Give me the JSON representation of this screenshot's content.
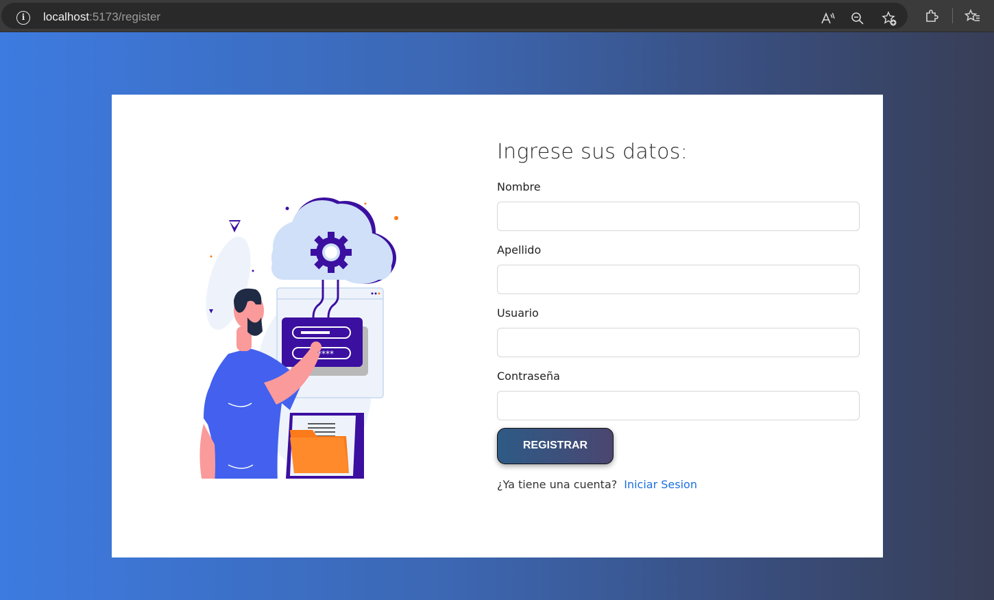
{
  "browser": {
    "url_host": "localhost",
    "url_rest": ":5173/register",
    "icons": [
      "info-icon",
      "read-aloud-icon",
      "zoom-out-icon",
      "favorite-add-icon",
      "extensions-icon",
      "favorites-icon"
    ]
  },
  "colors": {
    "background_start": "#3d7be0",
    "background_end": "#383e56",
    "button_start": "#2e5a85",
    "button_end": "#4b4670",
    "link": "#1a6fde",
    "illustration_purple": "#3b0fa0",
    "illustration_orange": "#fb7a1a",
    "illustration_blue": "#4361ee"
  },
  "form": {
    "title": "Ingrese sus datos:",
    "fields": [
      {
        "label": "Nombre",
        "value": "",
        "placeholder": ""
      },
      {
        "label": "Apellido",
        "value": "",
        "placeholder": ""
      },
      {
        "label": "Usuario",
        "value": "",
        "placeholder": ""
      },
      {
        "label": "Contraseña",
        "value": "",
        "placeholder": ""
      }
    ],
    "submit_label": "REGISTRAR",
    "login_prompt": "¿Ya tiene una cuenta?",
    "login_link": "Iniciar Sesion"
  },
  "illustration": {
    "password_mask": "******"
  }
}
